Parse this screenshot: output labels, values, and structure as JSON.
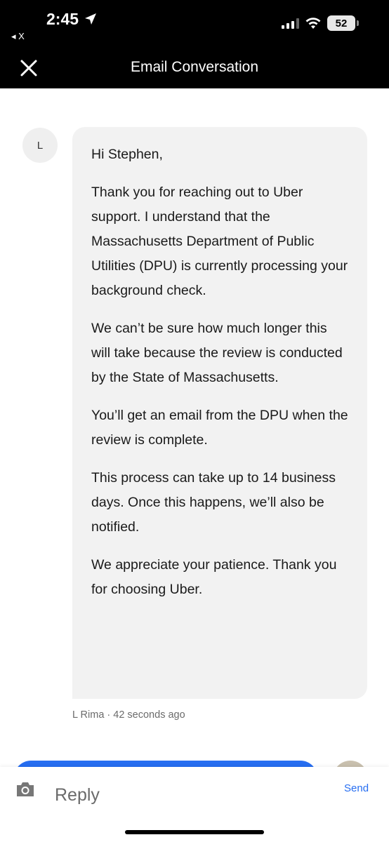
{
  "status_bar": {
    "time": "2:45",
    "back_app": "◂ X",
    "battery": "52"
  },
  "header": {
    "title": "Email Conversation",
    "close_icon": "close-icon"
  },
  "message": {
    "avatar_initial": "L",
    "paragraphs": [
      "Hi Stephen,",
      "Thank you for reaching out to Uber support. I understand that the Massachusetts Department of Public Utilities (DPU) is currently processing your background check.",
      "We can’t be sure how much longer this will take because the review is conducted by the State of Massachusetts.",
      "You’ll get an email from the DPU when the review is complete.",
      "This process can take up to 14 business days. Once this happens, we’ll also be notified.",
      "We appreciate your patience. Thank you for choosing Uber."
    ],
    "meta": "L Rima · 42 seconds ago"
  },
  "composer": {
    "placeholder": "Reply",
    "send_label": "Send",
    "camera_icon": "camera-icon"
  },
  "colors": {
    "accent": "#276ef1",
    "bubble": "#f2f2f2",
    "header_bg": "#000000"
  }
}
